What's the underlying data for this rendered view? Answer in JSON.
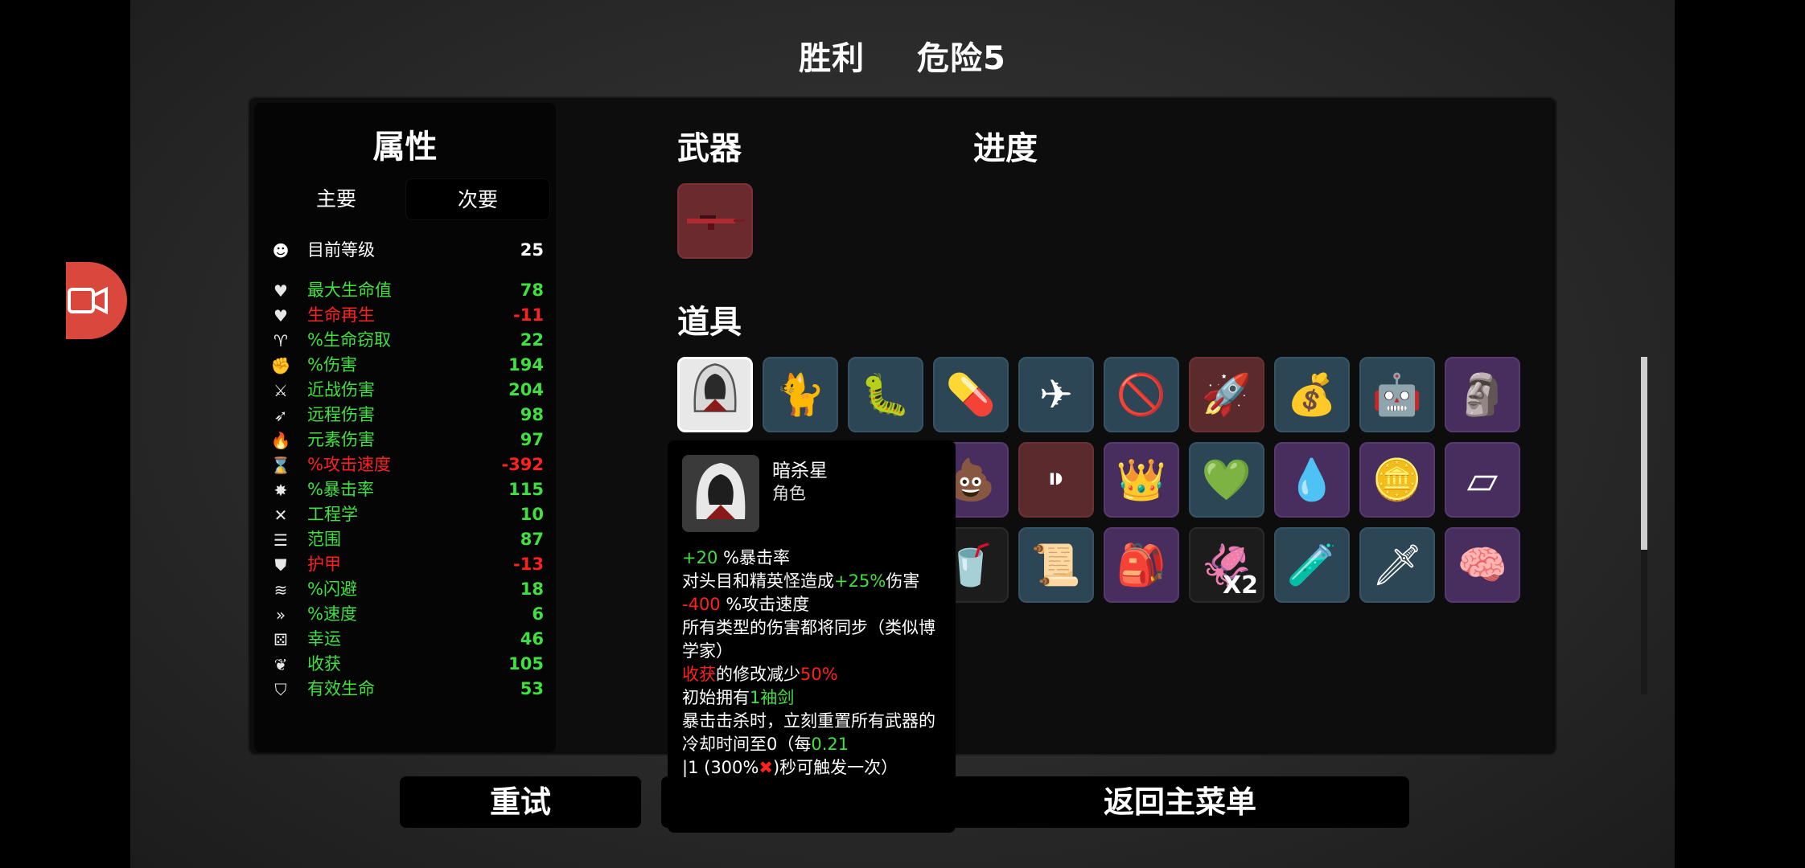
{
  "header": {
    "result": "胜利",
    "danger": "危险5"
  },
  "stats": {
    "heading": "属性",
    "tabs": {
      "primary": "主要",
      "secondary": "次要"
    },
    "level": {
      "label": "目前等级",
      "value": "25"
    },
    "rows": [
      {
        "icon": "heart-icon",
        "glyph": "♥",
        "label": "最大生命值",
        "value": "78",
        "color": "green"
      },
      {
        "icon": "heart-plus-icon",
        "glyph": "♥",
        "label": "生命再生",
        "value": "-11",
        "color": "red"
      },
      {
        "icon": "fang-icon",
        "glyph": "♈",
        "label": "%生命窃取",
        "value": "22",
        "color": "green"
      },
      {
        "icon": "muscle-icon",
        "glyph": "✊",
        "label": "%伤害",
        "value": "194",
        "color": "green"
      },
      {
        "icon": "sword-icon",
        "glyph": "⚔",
        "label": "近战伤害",
        "value": "204",
        "color": "green"
      },
      {
        "icon": "bow-icon",
        "glyph": "➶",
        "label": "远程伤害",
        "value": "98",
        "color": "green"
      },
      {
        "icon": "flame-icon",
        "glyph": "🔥",
        "label": "元素伤害",
        "value": "97",
        "color": "green"
      },
      {
        "icon": "hourglass-icon",
        "glyph": "⌛",
        "label": "%攻击速度",
        "value": "-392",
        "color": "red"
      },
      {
        "icon": "crit-icon",
        "glyph": "✸",
        "label": "%暴击率",
        "value": "115",
        "color": "green"
      },
      {
        "icon": "wrench-icon",
        "glyph": "✕",
        "label": "工程学",
        "value": "10",
        "color": "green"
      },
      {
        "icon": "range-icon",
        "glyph": "☰",
        "label": "范围",
        "value": "87",
        "color": "green"
      },
      {
        "icon": "shield-icon",
        "glyph": "⛊",
        "label": "护甲",
        "value": "-13",
        "color": "red"
      },
      {
        "icon": "dodge-icon",
        "glyph": "≋",
        "label": "%闪避",
        "value": "18",
        "color": "green"
      },
      {
        "icon": "speed-icon",
        "glyph": "»",
        "label": "%速度",
        "value": "6",
        "color": "green"
      },
      {
        "icon": "dice-icon",
        "glyph": "⚄",
        "label": "幸运",
        "value": "46",
        "color": "green"
      },
      {
        "icon": "wheat-icon",
        "glyph": "❦",
        "label": "收获",
        "value": "105",
        "color": "green"
      },
      {
        "icon": "shield-heart-icon",
        "glyph": "⛉",
        "label": "有效生命",
        "value": "53",
        "color": "green"
      }
    ]
  },
  "sections": {
    "weapons": "武器",
    "progress": "进度",
    "items": "道具"
  },
  "items": [
    {
      "name": "assassin-icon",
      "glyph": "",
      "bg": "white"
    },
    {
      "name": "ghost-cat-icon",
      "glyph": "🐈",
      "bg": "blue"
    },
    {
      "name": "worm-icon",
      "glyph": "🐛",
      "bg": "blue"
    },
    {
      "name": "pill-icon",
      "glyph": "💊",
      "bg": "blue"
    },
    {
      "name": "drone-icon",
      "glyph": "✈",
      "bg": "blue"
    },
    {
      "name": "no-pig-icon",
      "glyph": "🚫",
      "bg": "blue"
    },
    {
      "name": "rocket-icon",
      "glyph": "🚀",
      "bg": "red"
    },
    {
      "name": "hook-bag-icon",
      "glyph": "💰",
      "bg": "blue"
    },
    {
      "name": "robot-helmet-icon",
      "glyph": "🤖",
      "bg": "blue"
    },
    {
      "name": "idol-icon",
      "glyph": "🗿",
      "bg": "purple"
    },
    {
      "name": "flask-icon",
      "glyph": "⚗",
      "bg": "purple"
    },
    {
      "name": "zombie-icon",
      "glyph": "🧟",
      "bg": "purple"
    },
    {
      "name": "rock-alien-icon",
      "glyph": "🪨",
      "bg": "black"
    },
    {
      "name": "poop-icon",
      "glyph": "💩",
      "bg": "purple"
    },
    {
      "name": "bullet-icon",
      "glyph": "⁍",
      "bg": "red"
    },
    {
      "name": "crown-icon",
      "glyph": "👑",
      "bg": "purple"
    },
    {
      "name": "broken-heart-icon",
      "glyph": "💚",
      "bg": "blue"
    },
    {
      "name": "blood-drop-icon",
      "glyph": "💧",
      "bg": "purple"
    },
    {
      "name": "gold-coin-icon",
      "glyph": "🪙",
      "bg": "purple"
    },
    {
      "name": "eraser-icon",
      "glyph": "▱",
      "bg": "purple"
    },
    {
      "name": "target-icon",
      "glyph": "🎯",
      "bg": "black"
    },
    {
      "name": "crystal-ball-icon",
      "glyph": "🔮",
      "bg": "blue"
    },
    {
      "name": "blob-icon",
      "glyph": "🐷",
      "bg": "blue"
    },
    {
      "name": "cup-icon",
      "glyph": "🥤",
      "bg": "black"
    },
    {
      "name": "scroll-icon",
      "glyph": "📜",
      "bg": "blue"
    },
    {
      "name": "wizard-bag-icon",
      "glyph": "🎒",
      "bg": "purple"
    },
    {
      "name": "tentacle-icon",
      "glyph": "🦑",
      "bg": "black",
      "count": "X2"
    },
    {
      "name": "beaker-icon",
      "glyph": "🧪",
      "bg": "blue"
    },
    {
      "name": "broken-sword-icon",
      "glyph": "🗡",
      "bg": "blue"
    },
    {
      "name": "brain-icon",
      "glyph": "🧠",
      "bg": "purple"
    },
    {
      "name": "fire-trophy-icon",
      "glyph": "🏆",
      "bg": "blue"
    }
  ],
  "tooltip": {
    "name": "暗杀星",
    "type": "角色",
    "lines": [
      [
        {
          "t": "+20 ",
          "c": "green"
        },
        {
          "t": "%暴击率",
          "c": "white"
        }
      ],
      [
        {
          "t": "对头目和精英怪造成",
          "c": "white"
        },
        {
          "t": "+25%",
          "c": "green"
        },
        {
          "t": "伤害",
          "c": "white"
        }
      ],
      [
        {
          "t": "-400 ",
          "c": "red"
        },
        {
          "t": "%攻击速度",
          "c": "white"
        }
      ],
      [
        {
          "t": "所有类型的伤害都将同步（类似博学家）",
          "c": "white"
        }
      ],
      [
        {
          "t": "收获",
          "c": "red"
        },
        {
          "t": "的修改减少",
          "c": "white"
        },
        {
          "t": "50%",
          "c": "red"
        }
      ],
      [
        {
          "t": "初始拥有",
          "c": "white"
        },
        {
          "t": "1袖剑",
          "c": "green"
        }
      ],
      [
        {
          "t": "暴击击杀时，立刻重置所有武器的冷却时间至0（每",
          "c": "white"
        },
        {
          "t": "0.21",
          "c": "green"
        }
      ],
      [
        {
          "t": "|1 ",
          "c": "white"
        },
        {
          "t": "(300%",
          "c": "white"
        },
        {
          "t": "✖",
          "c": "red"
        },
        {
          "t": ")秒可触发一次）",
          "c": "white"
        }
      ]
    ]
  },
  "buttons": {
    "retry": "重试",
    "main_menu": "返回主菜单"
  }
}
